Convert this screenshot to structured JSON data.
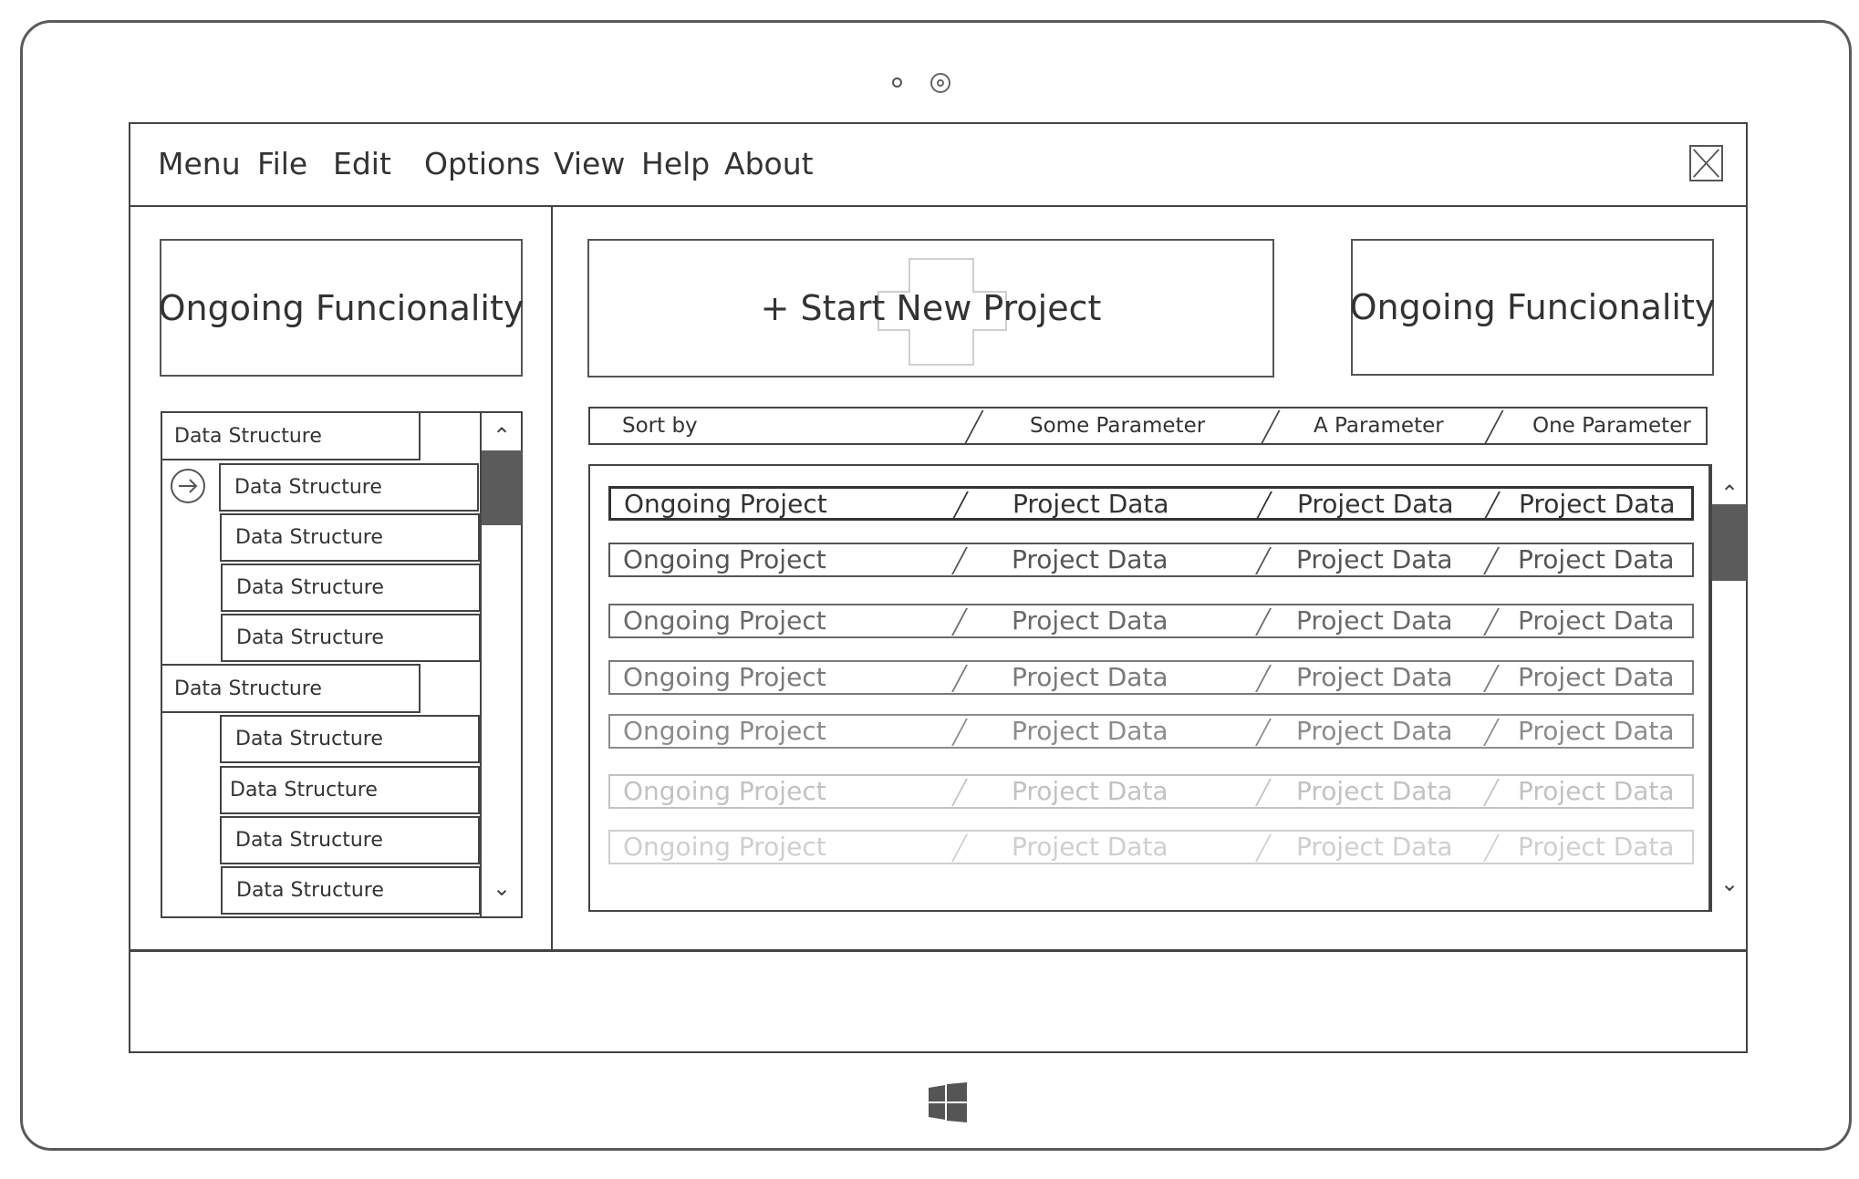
{
  "menu": {
    "items": [
      "Menu",
      "File",
      "Edit",
      "Options",
      "View",
      "Help",
      "About"
    ]
  },
  "left_panel": {
    "ongoing_label": "Ongoing Funcionality",
    "tree": {
      "groups": [
        {
          "label": "Data Structure",
          "children": [
            "Data Structure",
            "Data Structure",
            "Data Structure",
            "Data Structure"
          ]
        },
        {
          "label": "Data Structure",
          "children": [
            "Data Structure",
            "Data Structure",
            "Data Structure",
            "Data Structure"
          ]
        }
      ]
    }
  },
  "main": {
    "start_new_project_label": "+ Start New Project",
    "ongoing_label": "Ongoing Funcionality",
    "sort_bar": {
      "label": "Sort by",
      "parameters": [
        "Some Parameter",
        "A Parameter",
        "One Parameter"
      ]
    },
    "projects": [
      {
        "name": "Ongoing Project",
        "data": [
          "Project Data",
          "Project Data",
          "Project Data"
        ],
        "selected": true,
        "color": "#333333"
      },
      {
        "name": "Ongoing Project",
        "data": [
          "Project Data",
          "Project Data",
          "Project Data"
        ],
        "color": "#555555"
      },
      {
        "name": "Ongoing Project",
        "data": [
          "Project Data",
          "Project Data",
          "Project Data"
        ],
        "color": "#6a6a6a"
      },
      {
        "name": "Ongoing Project",
        "data": [
          "Project Data",
          "Project Data",
          "Project Data"
        ],
        "color": "#7a7a7a"
      },
      {
        "name": "Ongoing Project",
        "data": [
          "Project Data",
          "Project Data",
          "Project Data"
        ],
        "color": "#8c8c8c"
      },
      {
        "name": "Ongoing Project",
        "data": [
          "Project Data",
          "Project Data",
          "Project Data"
        ],
        "color": "#c2c2c2"
      },
      {
        "name": "Ongoing Project",
        "data": [
          "Project Data",
          "Project Data",
          "Project Data"
        ],
        "color": "#cfcfcf"
      }
    ]
  },
  "colors": {
    "outline": "#444444",
    "scroll_thumb": "#5b5b5b"
  }
}
